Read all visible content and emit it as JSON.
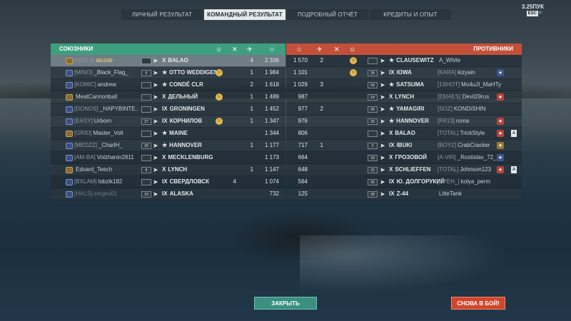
{
  "tabs": [
    "ЛИЧНЫЙ РЕЗУЛЬТАТ",
    "КОМАНДНЫЙ РЕЗУЛЬТАТ",
    "ПОДРОБНЫЙ ОТЧЁТ",
    "КРЕДИТЫ И ОПЫТ"
  ],
  "active_tab": 1,
  "version": "3.25ПУК",
  "esc_label": "ESC",
  "allies": {
    "title": "СОЮЗНИКИ",
    "players": [
      {
        "tag": "[NED-4]",
        "name": "alxzab",
        "rank": "",
        "tier": "X",
        "ship": "BALAO",
        "c1": "",
        "c2": "",
        "c3": "4",
        "score": "2 336",
        "smile": false,
        "me": true
      },
      {
        "tag": "[MINO]",
        "name": "_Black_Flag_",
        "rank": "6",
        "tier": "★",
        "ship": "OTTO WEDDIGEN",
        "c1": "",
        "c2": "",
        "c3": "1",
        "score": "1 984",
        "smile": true,
        "me": false
      },
      {
        "tag": "[KOMIC]",
        "name": "andrew",
        "rank": "",
        "tier": "★",
        "ship": "CONDÉ CLR",
        "c1": "",
        "c2": "",
        "c3": "2",
        "score": "1 618",
        "smile": false,
        "me": false
      },
      {
        "tag": "",
        "name": "MeatCannonball",
        "rank": "",
        "tier": "X",
        "ship": "ДЕЛЬНЫЙ",
        "c1": "",
        "c2": "",
        "c3": "1",
        "score": "1 489",
        "smile": true,
        "me": false
      },
      {
        "tag": "[DONOS]",
        "name": "_HAPYBINTE..",
        "rank": "",
        "tier": "IX",
        "ship": "GRONINGEN",
        "c1": "",
        "c2": "",
        "c3": "1",
        "score": "1 452",
        "smile": false,
        "me": false
      },
      {
        "tag": "[EASY]",
        "name": "Urborn",
        "rank": "27",
        "tier": "IX",
        "ship": "КОРНИЛОВ",
        "c1": "",
        "c2": "",
        "c3": "1",
        "score": "1 347",
        "smile": true,
        "me": false
      },
      {
        "tag": "[GRID]",
        "name": "Master_Volt",
        "rank": "",
        "tier": "★",
        "ship": "MAINE",
        "c1": "",
        "c2": "",
        "c3": "",
        "score": "1 344",
        "smile": false,
        "me": false
      },
      {
        "tag": "[MEDZZ]",
        "name": "_CharlH_",
        "rank": "29",
        "tier": "★",
        "ship": "HANNOVER",
        "c1": "",
        "c2": "",
        "c3": "1",
        "score": "1 177",
        "smile": false,
        "me": false
      },
      {
        "tag": "[AM-BA]",
        "name": "Volzhanin2811",
        "rank": "",
        "tier": "X",
        "ship": "MECKLENBURG",
        "c1": "",
        "c2": "",
        "c3": "",
        "score": "1 173",
        "smile": false,
        "me": false
      },
      {
        "tag": "",
        "name": "Edvard_Teech",
        "rank": "8",
        "tier": "X",
        "ship": "LYNCH",
        "c1": "",
        "c2": "",
        "c3": "1",
        "score": "1 147",
        "smile": false,
        "me": false
      },
      {
        "tag": "[BXLAM]",
        "name": "lobzik182",
        "rank": "",
        "tier": "IX",
        "ship": "СВЕРДЛОВСК",
        "c1": "4",
        "c2": "",
        "c3": "",
        "score": "1 074",
        "smile": false,
        "me": false
      },
      {
        "tag": "[HALS]",
        "name": "sergev01",
        "rank": "19",
        "tier": "IX",
        "ship": "ALASKA",
        "c1": "",
        "c2": "",
        "c3": "",
        "score": "732",
        "smile": false,
        "me": false,
        "dead": true
      }
    ]
  },
  "enemies": {
    "title": "ПРОТИВНИКИ",
    "players": [
      {
        "score": "1 570",
        "c1": "2",
        "c2": "",
        "smile": true,
        "tier": "★",
        "ship": "CLAUSEWITZ",
        "tag": "",
        "name": "A_White",
        "badge": "",
        "div": ""
      },
      {
        "score": "1 101",
        "c1": "",
        "c2": "",
        "smile": true,
        "rank": "28",
        "tier": "IX",
        "ship": "IOWA",
        "tag": "[KARA]",
        "name": "kizyain",
        "badge": "b",
        "div": ""
      },
      {
        "score": "1 029",
        "c1": "3",
        "c2": "",
        "smile": false,
        "rank": "54",
        "tier": "★",
        "ship": "SATSUMA",
        "tag": "[1SHOT]",
        "name": "Mo4uJI_MaHTy",
        "badge": "",
        "div": ""
      },
      {
        "score": "987",
        "c1": "",
        "c2": "",
        "smile": false,
        "rank": "14",
        "tier": "X",
        "ship": "LYNCH",
        "tag": "[EMAES]",
        "name": "Devil29rus",
        "badge": "r",
        "div": ""
      },
      {
        "score": "977",
        "c1": "2",
        "c2": "",
        "smile": false,
        "rank": "26",
        "tier": "★",
        "ship": "YAMAGIRI",
        "tag": "[SOZ]",
        "name": "KONDISHIN",
        "badge": "",
        "div": ""
      },
      {
        "score": "976",
        "c1": "",
        "c2": "",
        "smile": false,
        "rank": "26",
        "tier": "★",
        "ship": "HANNOVER",
        "tag": "[FR13]",
        "name": "roma",
        "badge": "r",
        "div": ""
      },
      {
        "score": "806",
        "c1": "",
        "c2": "",
        "smile": false,
        "rank": "",
        "tier": "X",
        "ship": "BALAO",
        "tag": "[TOTAL]",
        "name": "TrickStyle",
        "badge": "r",
        "div": "A"
      },
      {
        "score": "717",
        "c1": "1",
        "c2": "",
        "smile": false,
        "rank": "2",
        "tier": "IX",
        "ship": "IBUKI",
        "tag": "[BOYZ]",
        "name": "CrabCracker",
        "badge": "g",
        "div": ""
      },
      {
        "score": "664",
        "c1": "",
        "c2": "",
        "smile": false,
        "rank": "18",
        "tier": "X",
        "ship": "ГРОЗОВОЙ",
        "tag": "[A-VIR]",
        "name": "_Rostislav_72_",
        "badge": "b",
        "div": ""
      },
      {
        "score": "648",
        "c1": "",
        "c2": "",
        "smile": false,
        "rank": "22",
        "tier": "X",
        "ship": "SCHLIEFFEN",
        "tag": "[TOTAL]",
        "name": "Johnson123",
        "badge": "r",
        "div": "A"
      },
      {
        "score": "564",
        "c1": "",
        "c2": "",
        "smile": false,
        "rank": "26",
        "tier": "IX",
        "ship": "Ю. ДОЛГОРУКИЙ",
        "tag": "[KPEH_]",
        "name": "kolya_perm",
        "badge": "",
        "div": ""
      },
      {
        "score": "125",
        "c1": "",
        "c2": "",
        "smile": false,
        "rank": "28",
        "tier": "IX",
        "ship": "Z-44",
        "tag": "",
        "name": "LitteTank",
        "badge": "",
        "div": ""
      }
    ]
  },
  "buttons": {
    "close": "ЗАКРЫТЬ",
    "again": "СНОВА В БОЙ!"
  },
  "colors": {
    "ally_header": "#3e9f7e",
    "enemy_header": "#c4503a",
    "close_button": "#3b8f7f",
    "again_button": "#d0462a"
  }
}
